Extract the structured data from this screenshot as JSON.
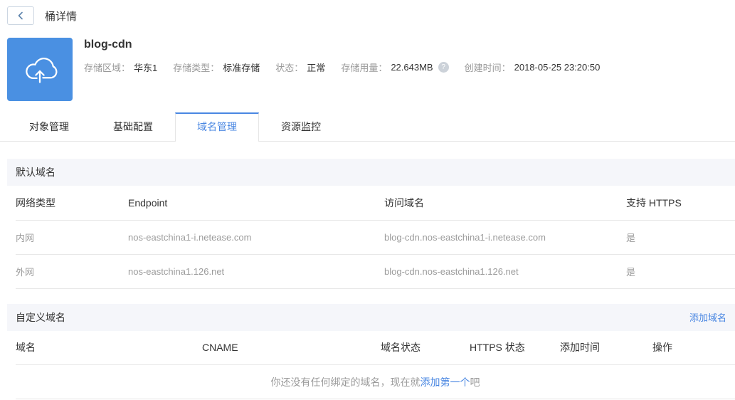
{
  "page_header": {
    "title": "桶详情"
  },
  "bucket": {
    "name": "blog-cdn",
    "icon": "cloud-upload-icon",
    "info": [
      {
        "label": "存储区域：",
        "value": "华东1"
      },
      {
        "label": "存储类型：",
        "value": "标准存储"
      },
      {
        "label": "状态：",
        "value": "正常"
      },
      {
        "label": "存储用量：",
        "value": "22.643MB",
        "help_icon": "question-circle-icon"
      },
      {
        "label": "创建时间：",
        "value": "2018-05-25 23:20:50"
      }
    ]
  },
  "tabs": [
    {
      "label": "对象管理",
      "active": false
    },
    {
      "label": "基础配置",
      "active": false
    },
    {
      "label": "域名管理",
      "active": true
    },
    {
      "label": "资源监控",
      "active": false
    }
  ],
  "default_domain": {
    "section_title": "默认域名",
    "table": {
      "headers": [
        "网络类型",
        "Endpoint",
        "访问域名",
        "支持 HTTPS"
      ],
      "rows": [
        [
          "内网",
          "nos-eastchina1-i.netease.com",
          "blog-cdn.nos-eastchina1-i.netease.com",
          "是"
        ],
        [
          "外网",
          "nos-eastchina1.126.net",
          "blog-cdn.nos-eastchina1.126.net",
          "是"
        ]
      ]
    }
  },
  "custom_domain": {
    "section_title": "自定义域名",
    "add_link": "添加域名",
    "table": {
      "headers": [
        "域名",
        "CNAME",
        "域名状态",
        "HTTPS 状态",
        "添加时间",
        "操作"
      ]
    },
    "empty_state": {
      "prefix": "你还没有任何绑定的域名，现在就",
      "link": "添加第一个",
      "suffix": "吧"
    }
  },
  "colors": {
    "accent": "#4a87e2",
    "icon_bg": "#4a90e2",
    "section_bg": "#f5f6fa",
    "border": "#e6e6e6",
    "text_gray": "#9b9b9b"
  }
}
